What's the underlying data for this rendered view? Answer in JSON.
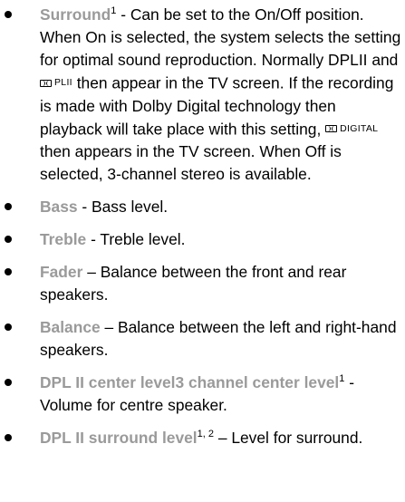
{
  "items": [
    {
      "term": "Surround",
      "sup": "1",
      "part1": " - Can be set to the On/Off posi­tion. When On is selected, the system selects the setting for optimal sound repro­duction. Normally DPLII and ",
      "logo1_text": "PLII",
      "part2": " then appear in the TV screen. If the recording is made with Dolby Digital technology then playback will take place with this setting, ",
      "logo2_text": "DIGITAL",
      "part3": " then appears in the TV screen. When Off is selected, 3-channel stereo is available."
    },
    {
      "term": "Bass",
      "text": " - Bass level."
    },
    {
      "term": "Treble",
      "text": " - Treble level."
    },
    {
      "term": "Fader",
      "text": " – Balance between the front and rear speakers."
    },
    {
      "term": "Balance",
      "text": " – Balance between the left and right-hand speakers."
    },
    {
      "term": "DPL II center level3 channel center level",
      "sup": "1",
      "text": " - Volume for centre speaker."
    },
    {
      "term": "DPL II surround level",
      "sup": "1, 2",
      "text": " – Level for sur­round."
    }
  ]
}
